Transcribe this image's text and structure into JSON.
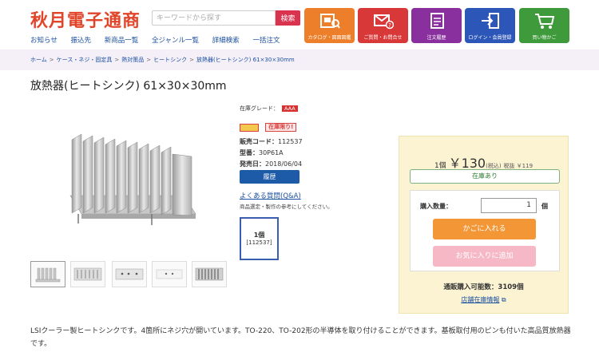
{
  "site": {
    "logo": "秋月電子通商",
    "search": {
      "placeholder": "キーワードから探す",
      "button": "検索"
    },
    "nav": [
      "お知らせ",
      "振込先",
      "新商品一覧",
      "全ジャンル一覧",
      "詳細検索",
      "一括注文"
    ],
    "tiles": [
      {
        "label": "カタログ・図面図鑑",
        "color": "#ee7f2a",
        "icon": "catalog-icon"
      },
      {
        "label": "ご質問・お問合せ",
        "color": "#d93838",
        "icon": "mail-icon"
      },
      {
        "label": "注文履歴",
        "color": "#8a2f9e",
        "icon": "order-history-icon"
      },
      {
        "label": "ログイン・会員登録",
        "color": "#2c56b8",
        "icon": "login-icon"
      },
      {
        "label": "買い物かご",
        "color": "#3e9a3a",
        "icon": "cart-icon"
      }
    ]
  },
  "breadcrumb": [
    "ホーム",
    "ケース・ネジ・固定具",
    "熱対策品",
    "ヒートシンク",
    "放熱器(ヒートシンク) 61×30×30mm"
  ],
  "product": {
    "title": "放熱器(ヒートシンク) 61×30×30mm",
    "grade_label": "在庫グレード：",
    "grade_value": "AAA",
    "stock_limited": "在庫限り!",
    "code_label": "販売コード：",
    "code": "112537",
    "model_label": "型番：",
    "model": "30P61A",
    "release_label": "発売日：",
    "release": "2018/06/04",
    "history_button": "履歴",
    "faq_link": "よくある質問(Q&A)",
    "faq_note": "商品選定・製作の参考にしてください。",
    "pack_qty": "1個",
    "pack_code": "[112537]",
    "description": "LSIクーラー製ヒートシンクです。4箇所にネジ穴が開いています。TO-220、TO-202形の半導体を取り付けることができます。基板取付用のピンも付いた高品質放熱器です。"
  },
  "purchase": {
    "unit": "1個",
    "price": "￥130",
    "tax_in": "(税込)",
    "tax_ex": "税抜 ￥119",
    "stock_status": "在庫あり",
    "qty_label": "購入数量：",
    "qty_value": "1",
    "qty_unit": "個",
    "cart_button": "かごに入れる",
    "fav_button": "お気に入りに追加",
    "available": "通販購入可能数：3109個",
    "store_link": "店舗在庫情報"
  }
}
